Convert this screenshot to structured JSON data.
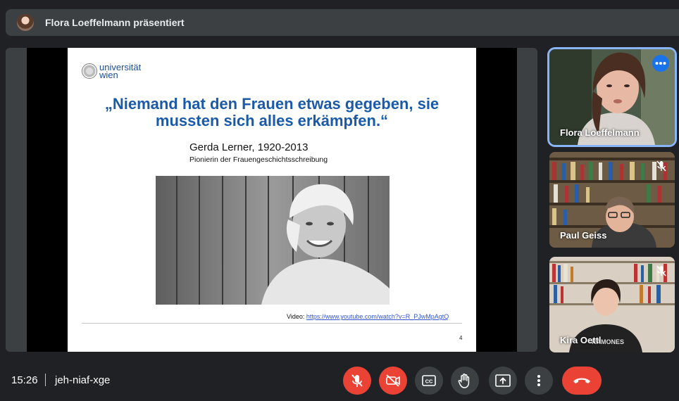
{
  "presenter_bar": {
    "text": "Flora Loeffelmann präsentiert",
    "avatar": "presenter-avatar"
  },
  "slide": {
    "logo_line1": "universität",
    "logo_line2": "wien",
    "quote_line1": "„Niemand hat den Frauen etwas gegeben, sie",
    "quote_line2": "mussten sich alles erkämpfen.“",
    "author": "Gerda Lerner, 1920-2013",
    "author_subtitle": "Pionierin der Frauengeschichtsschreibung",
    "video_label": "Video:",
    "video_link": "https://www.youtube.com/watch?v=R_PJwMpAgtQ",
    "page_number": "4",
    "photo": "portrait-photo"
  },
  "participants": [
    {
      "name": "Flora Loeffelmann",
      "active": true,
      "icon": "more-options-icon"
    },
    {
      "name": "Paul Geiss",
      "muted": true,
      "icon": "mic-off-icon"
    },
    {
      "name": "Kira Oettl",
      "muted": true,
      "icon": "mic-off-icon"
    }
  ],
  "meeting": {
    "time": "15:26",
    "code": "jeh-niaf-xge"
  },
  "controls": [
    {
      "name": "microphone-off",
      "icon": "mic-off-icon",
      "color": "#ea4335"
    },
    {
      "name": "camera-off",
      "icon": "camera-off-icon",
      "color": "#ea4335"
    },
    {
      "name": "captions",
      "icon": "captions-icon",
      "color": "#3c4043"
    },
    {
      "name": "raise-hand",
      "icon": "hand-icon",
      "color": "#3c4043"
    },
    {
      "name": "present-now",
      "icon": "present-icon",
      "color": "#3c4043"
    },
    {
      "name": "more-options",
      "icon": "more-vert-icon",
      "color": "#3c4043"
    },
    {
      "name": "leave-call",
      "icon": "phone-hangup-icon",
      "color": "#ea4335"
    }
  ],
  "colors": {
    "background": "#202124",
    "surface": "#3c4043",
    "danger": "#ea4335",
    "accent": "#1a73e8",
    "active_border": "#8ab4f8",
    "quote_text": "#1a5aa8"
  }
}
